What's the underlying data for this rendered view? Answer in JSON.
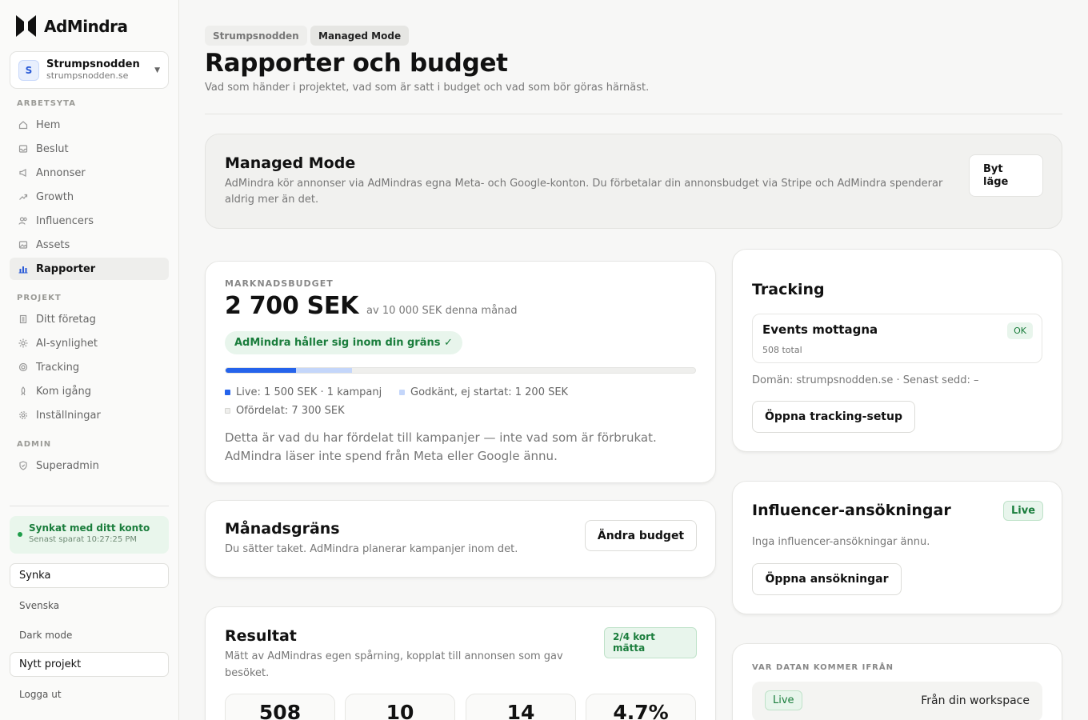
{
  "brand": {
    "name": "AdMindra"
  },
  "workspace": {
    "initial": "S",
    "name": "Strumpsnodden",
    "domain": "strumpsnodden.se"
  },
  "sidebar": {
    "sections": {
      "workspace": "ARBETSYTA",
      "project": "PROJEKT",
      "admin": "ADMIN"
    },
    "items": [
      {
        "label": "Hem",
        "icon": "home-icon"
      },
      {
        "label": "Beslut",
        "icon": "inbox-icon"
      },
      {
        "label": "Annonser",
        "icon": "megaphone-icon"
      },
      {
        "label": "Growth",
        "icon": "trend-icon"
      },
      {
        "label": "Influencers",
        "icon": "users-icon"
      },
      {
        "label": "Assets",
        "icon": "image-icon"
      },
      {
        "label": "Rapporter",
        "icon": "bar-chart-icon",
        "active": true
      }
    ],
    "project_items": [
      {
        "label": "Ditt företag",
        "icon": "building-icon"
      },
      {
        "label": "AI-synlighet",
        "icon": "sparkle-icon"
      },
      {
        "label": "Tracking",
        "icon": "target-icon"
      },
      {
        "label": "Kom igång",
        "icon": "rocket-icon"
      },
      {
        "label": "Inställningar",
        "icon": "gear-icon"
      }
    ],
    "admin_items": [
      {
        "label": "Superadmin",
        "icon": "shield-icon"
      }
    ],
    "sync": {
      "title": "Synkat med ditt konto",
      "subtitle": "Senast sparat 10:27:25 PM"
    },
    "sync_button": "Synka",
    "language": "Svenska",
    "dark_mode": "Dark mode",
    "new_project": "Nytt projekt",
    "logout": "Logga ut"
  },
  "header": {
    "breadcrumb": [
      "Strumpsnodden",
      "Managed Mode"
    ],
    "title": "Rapporter och budget",
    "subtitle": "Vad som händer i projektet, vad som är satt i budget och vad som bör göras härnäst."
  },
  "managed_mode": {
    "title": "Managed Mode",
    "description": "AdMindra kör annonser via AdMindras egna Meta- och Google-konton. Du förbetalar din annonsbudget via Stripe och AdMindra spenderar aldrig mer än det.",
    "button_line1": "Byt",
    "button_line2": "läge"
  },
  "budget": {
    "eyebrow": "MARKNADSBUDGET",
    "amount": "2 700 SEK",
    "of_text": "av 10 000 SEK denna månad",
    "limit_status": "AdMindra håller sig inom din gräns ✓",
    "progress": {
      "live_fraction": 0.15,
      "approved_fraction": 0.12
    },
    "legend_live": "Live: 1 500 SEK · 1 kampanj",
    "legend_approved": "Godkänt, ej startat: 1 200 SEK",
    "legend_unallocated": "Ofördelat: 7 300 SEK",
    "note": "Detta är vad du har fördelat till kampanjer — inte vad som är förbrukat. AdMindra läser inte spend från Meta eller Google ännu."
  },
  "monthly_limit": {
    "title": "Månadsgräns",
    "description": "Du sätter taket. AdMindra planerar kampanjer inom det.",
    "button": "Ändra budget"
  },
  "results": {
    "title": "Resultat",
    "description": "Mätt av AdMindras egen spårning, kopplat till annonsen som gav besöket.",
    "badge_line1": "2/4 kort",
    "badge_line2": "mätta",
    "stats": [
      "508",
      "10",
      "14",
      "4.7%"
    ]
  },
  "tracking": {
    "title": "Tracking",
    "events_title": "Events mottagna",
    "events_sub": "508 total",
    "status": "OK",
    "domain_line": "Domän: strumpsnodden.se · Senast sedd: –",
    "button": "Öppna tracking-setup"
  },
  "influencer": {
    "title": "Influencer-ansökningar",
    "badge": "Live",
    "empty": "Inga influencer-ansökningar ännu.",
    "button": "Öppna ansökningar"
  },
  "data_source": {
    "eyebrow": "VAR DATAN KOMMER IFRÅN",
    "badge": "Live",
    "source": "Från din workspace"
  },
  "colors": {
    "accent": "#2563eb",
    "success": "#1a7d3c",
    "success_bg": "#e8f5ec"
  }
}
